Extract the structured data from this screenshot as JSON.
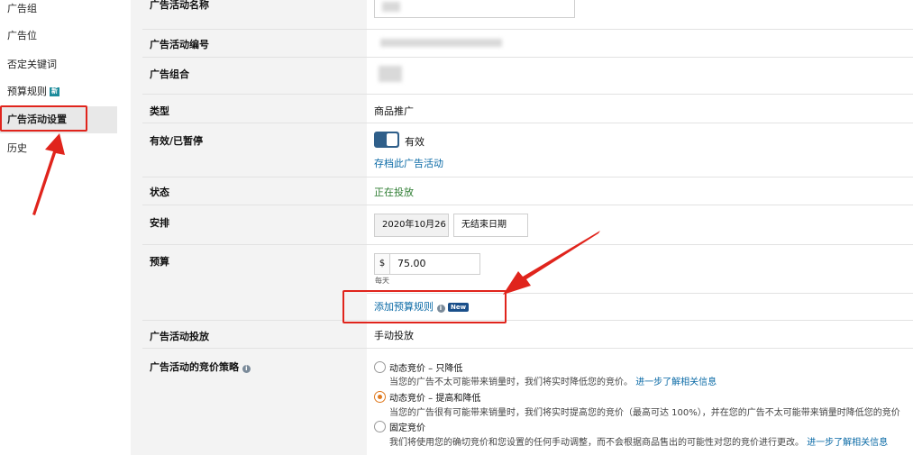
{
  "sidebar": {
    "items": [
      {
        "label": "广告组"
      },
      {
        "label": "广告位"
      },
      {
        "label": "否定关键词"
      },
      {
        "label": "预算规则",
        "badge": "新"
      },
      {
        "label": "广告活动设置"
      },
      {
        "label": "历史"
      }
    ]
  },
  "settings": {
    "campaign_name": {
      "label": "广告活动名称"
    },
    "campaign_id": {
      "label": "广告活动编号"
    },
    "portfolio": {
      "label": "广告组合"
    },
    "type": {
      "label": "类型",
      "value": "商品推广"
    },
    "active": {
      "label": "有效/已暂停",
      "toggle_label": "有效",
      "archive_link": "存档此广告活动",
      "toggle_on": true
    },
    "status": {
      "label": "状态",
      "value": "正在投放",
      "color": "#2e7d32"
    },
    "schedule": {
      "label": "安排",
      "start_date": "2020年10月26",
      "end_date": "无结束日期"
    },
    "budget": {
      "label": "预算",
      "currency": "$",
      "amount": "75.00",
      "period": "每天",
      "rule_link": "添加预算规则",
      "new_badge": "New"
    },
    "delivery": {
      "label": "广告活动投放",
      "value": "手动投放"
    },
    "bidding": {
      "label": "广告活动的竞价策略",
      "options": [
        {
          "title": "动态竞价 – 只降低",
          "desc": "当您的广告不太可能带来销量时，我们将实时降低您的竞价。",
          "link": "进一步了解相关信息",
          "checked": false
        },
        {
          "title": "动态竞价 – 提高和降低",
          "desc": "当您的广告很有可能带来销量时，我们将实时提高您的竞价（最高可达 100%），并在您的广告不太可能带来销量时降低您的竞价",
          "link": "",
          "checked": true
        },
        {
          "title": "固定竞价",
          "desc": "我们将使用您的确切竞价和您设置的任何手动调整，而不会根据商品售出的可能性对您的竞价进行更改。",
          "link": "进一步了解相关信息",
          "checked": false
        }
      ]
    }
  },
  "colors": {
    "link": "#0a6aa6",
    "annotation": "#e0241c",
    "toggle": "#2f5f8a",
    "radio_checked": "#e07a1f"
  }
}
